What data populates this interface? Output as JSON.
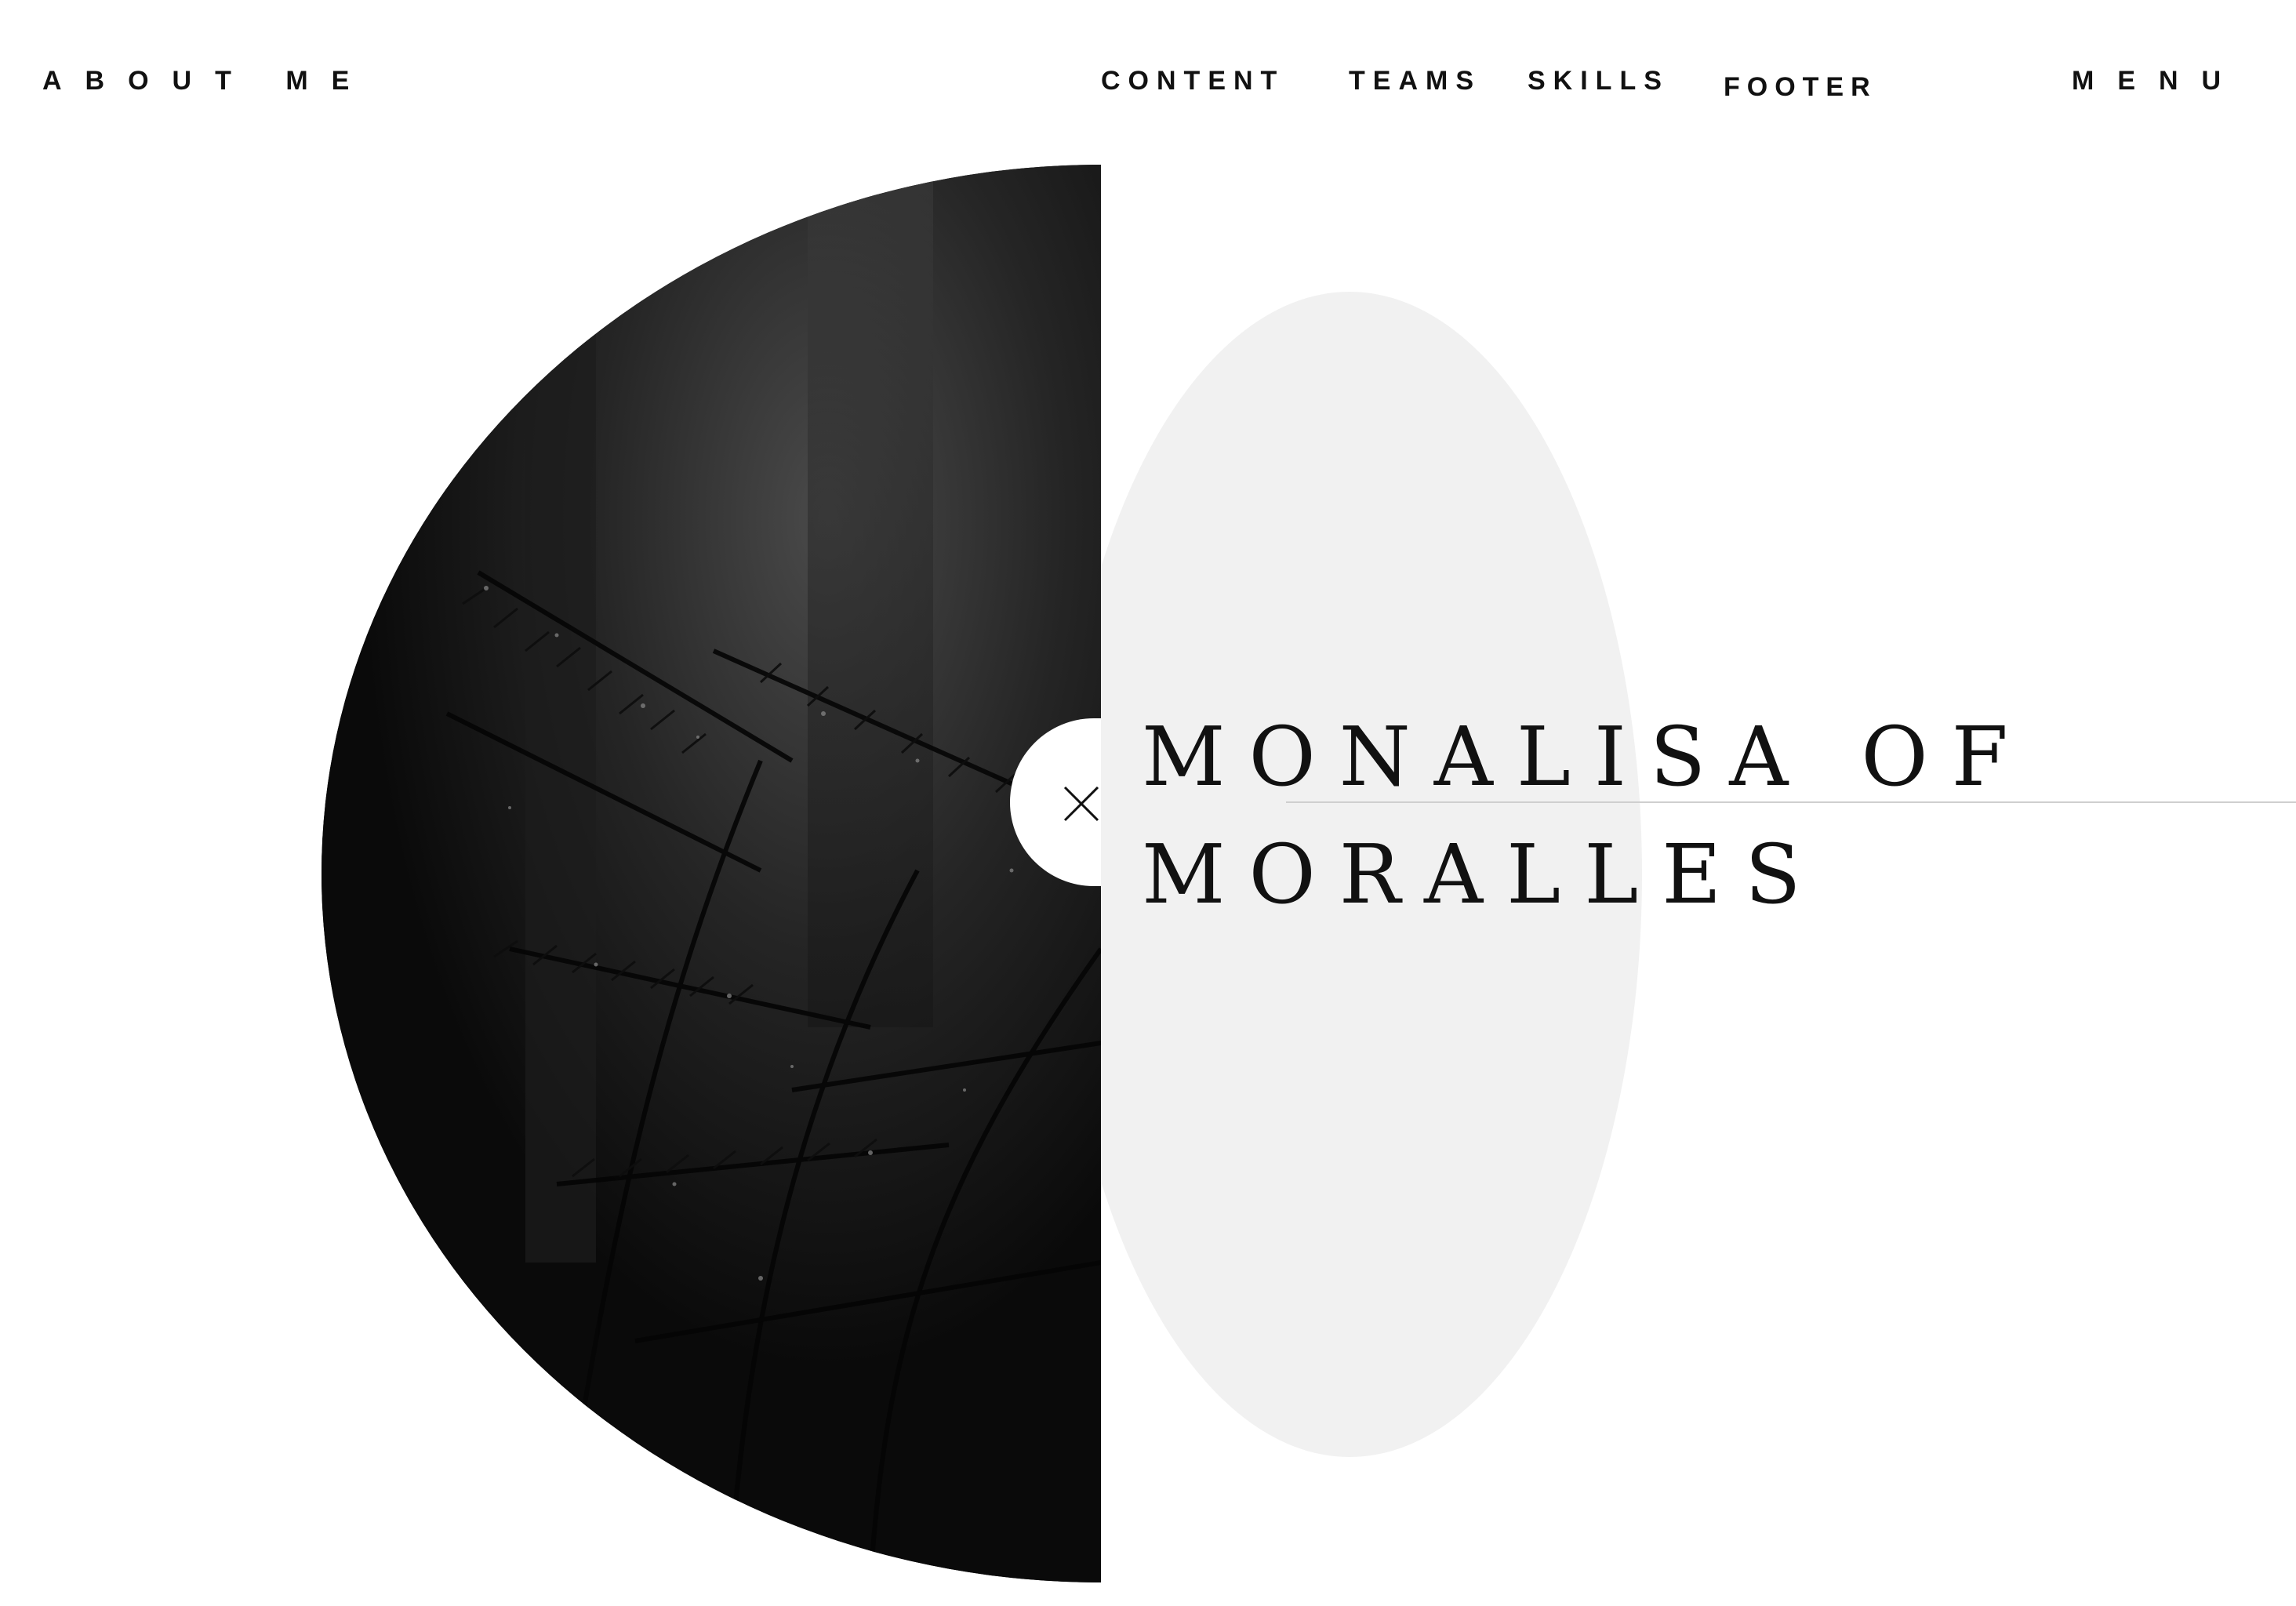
{
  "header": {
    "brand": "ABOUT ME",
    "nav_links": [
      "CONTENT",
      "TEAMS",
      "SKILLS",
      "FOOTER"
    ],
    "menu_label": "MENU"
  },
  "hero": {
    "title_line1": "MONALISA OF",
    "title_line2": "MORALLES",
    "image_description_icon": "close-icon"
  },
  "colors": {
    "background": "#ffffff",
    "text": "#111111",
    "light_disc": "#f1f1f1",
    "dark_photo": "#0c0c0c"
  }
}
